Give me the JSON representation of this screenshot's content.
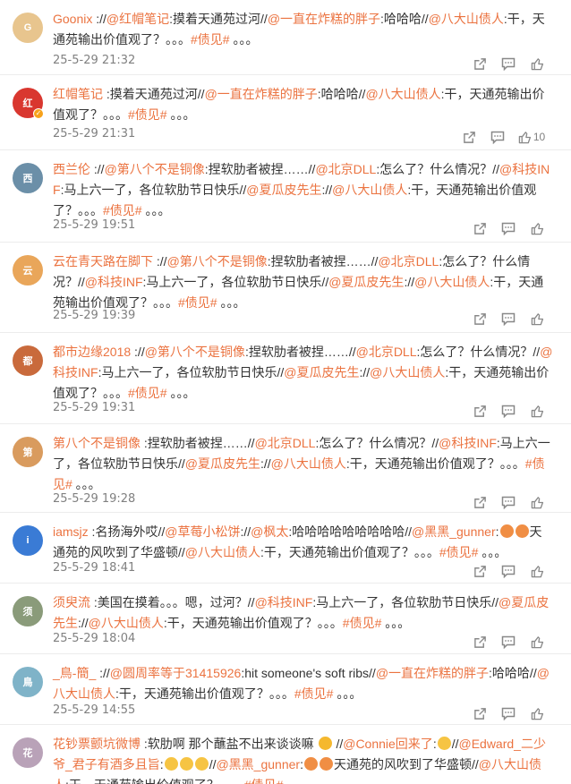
{
  "comments": [
    {
      "name": "Goonix",
      "avatar": {
        "color": "#e8c58e",
        "text": "G"
      },
      "segments": [
        {
          "t": "txt",
          "v": " ://"
        },
        {
          "t": "at",
          "v": "@红帽笔记"
        },
        {
          "t": "txt",
          "v": ":摸着天通苑过河//"
        },
        {
          "t": "at",
          "v": "@一直在炸糕的胖子"
        },
        {
          "t": "txt",
          "v": ":哈哈哈//"
        },
        {
          "t": "at",
          "v": "@八大山债人"
        },
        {
          "t": "txt",
          "v": ":干，天通苑输出价值观了？。。。"
        },
        {
          "t": "tag",
          "v": "#债见#"
        },
        {
          "t": "txt",
          "v": " 。。。"
        }
      ],
      "time": "25-5-29 21:32",
      "likes": ""
    },
    {
      "name": "红帽笔记",
      "avatar": {
        "color": "#d9372f",
        "text": "红",
        "badge": true
      },
      "segments": [
        {
          "t": "txt",
          "v": " :摸着天通苑过河//"
        },
        {
          "t": "at",
          "v": "@一直在炸糕的胖子"
        },
        {
          "t": "txt",
          "v": ":哈哈哈//"
        },
        {
          "t": "at",
          "v": "@八大山债人"
        },
        {
          "t": "txt",
          "v": ":干，天通苑输出价值观了？。。。"
        },
        {
          "t": "tag",
          "v": "#债见#"
        },
        {
          "t": "txt",
          "v": " 。。。"
        }
      ],
      "time": "25-5-29 21:31",
      "likes": "10"
    },
    {
      "name": "西兰伦",
      "avatar": {
        "color": "#6b8fa8",
        "text": "西"
      },
      "segments": [
        {
          "t": "txt",
          "v": " ://"
        },
        {
          "t": "at",
          "v": "@第八个不是铜像"
        },
        {
          "t": "txt",
          "v": ":捏软肋者被捏……//"
        },
        {
          "t": "at",
          "v": "@北京DLL"
        },
        {
          "t": "txt",
          "v": ":怎么了？什么情况？//"
        },
        {
          "t": "at",
          "v": "@科技INF"
        },
        {
          "t": "txt",
          "v": ":马上六一了，各位软肋节日快乐//"
        },
        {
          "t": "at",
          "v": "@夏瓜皮先生"
        },
        {
          "t": "txt",
          "v": "://"
        },
        {
          "t": "at",
          "v": "@八大山债人"
        },
        {
          "t": "txt",
          "v": ":干，天通苑输出价值观了？。。。"
        },
        {
          "t": "tag",
          "v": "#债见#"
        },
        {
          "t": "txt",
          "v": " 。。。"
        }
      ],
      "time": "25-5-29 19:51",
      "likes": ""
    },
    {
      "name": "云在青天路在脚下",
      "avatar": {
        "color": "#e9a65a",
        "text": "云"
      },
      "segments": [
        {
          "t": "txt",
          "v": " ://"
        },
        {
          "t": "at",
          "v": "@第八个不是铜像"
        },
        {
          "t": "txt",
          "v": ":捏软肋者被捏……//"
        },
        {
          "t": "at",
          "v": "@北京DLL"
        },
        {
          "t": "txt",
          "v": ":怎么了？什么情况？//"
        },
        {
          "t": "at",
          "v": "@科技INF"
        },
        {
          "t": "txt",
          "v": ":马上六一了，各位软肋节日快乐//"
        },
        {
          "t": "at",
          "v": "@夏瓜皮先生"
        },
        {
          "t": "txt",
          "v": "://"
        },
        {
          "t": "at",
          "v": "@八大山债人"
        },
        {
          "t": "txt",
          "v": ":干，天通苑输出价值观了？。。。"
        },
        {
          "t": "tag",
          "v": "#债见#"
        },
        {
          "t": "txt",
          "v": " 。。。"
        }
      ],
      "time": "25-5-29 19:39",
      "likes": ""
    },
    {
      "name": "都市边缘2018",
      "avatar": {
        "color": "#c96a3c",
        "text": "都"
      },
      "segments": [
        {
          "t": "txt",
          "v": " ://"
        },
        {
          "t": "at",
          "v": "@第八个不是铜像"
        },
        {
          "t": "txt",
          "v": ":捏软肋者被捏……//"
        },
        {
          "t": "at",
          "v": "@北京DLL"
        },
        {
          "t": "txt",
          "v": ":怎么了？什么情况？//"
        },
        {
          "t": "at",
          "v": "@科技INF"
        },
        {
          "t": "txt",
          "v": ":马上六一了，各位软肋节日快乐//"
        },
        {
          "t": "at",
          "v": "@夏瓜皮先生"
        },
        {
          "t": "txt",
          "v": "://"
        },
        {
          "t": "at",
          "v": "@八大山债人"
        },
        {
          "t": "txt",
          "v": ":干，天通苑输出价值观了？。。。"
        },
        {
          "t": "tag",
          "v": "#债见#"
        },
        {
          "t": "txt",
          "v": " 。。。"
        }
      ],
      "time": "25-5-29 19:31",
      "likes": ""
    },
    {
      "name": "第八个不是铜像",
      "avatar": {
        "color": "#d99b5e",
        "text": "第"
      },
      "segments": [
        {
          "t": "txt",
          "v": " :捏软肋者被捏……//"
        },
        {
          "t": "at",
          "v": "@北京DLL"
        },
        {
          "t": "txt",
          "v": ":怎么了？什么情况？//"
        },
        {
          "t": "at",
          "v": "@科技INF"
        },
        {
          "t": "txt",
          "v": ":马上六一了，各位软肋节日快乐//"
        },
        {
          "t": "at",
          "v": "@夏瓜皮先生"
        },
        {
          "t": "txt",
          "v": "://"
        },
        {
          "t": "at",
          "v": "@八大山债人"
        },
        {
          "t": "txt",
          "v": ":干，天通苑输出价值观了？。。。"
        },
        {
          "t": "tag",
          "v": "#债见#"
        },
        {
          "t": "txt",
          "v": " 。。。"
        }
      ],
      "time": "25-5-29 19:28",
      "likes": ""
    },
    {
      "name": "iamsjz",
      "avatar": {
        "color": "#3a7bd5",
        "text": "i"
      },
      "segments": [
        {
          "t": "txt",
          "v": " :名扬海外哎//"
        },
        {
          "t": "at",
          "v": "@草莓小松饼"
        },
        {
          "t": "txt",
          "v": "://"
        },
        {
          "t": "at",
          "v": "@枫太"
        },
        {
          "t": "txt",
          "v": ":哈哈哈哈哈哈哈哈哈//"
        },
        {
          "t": "at",
          "v": "@黑黑_gunner"
        },
        {
          "t": "txt",
          "v": ":"
        },
        {
          "t": "emoji",
          "v": "cry"
        },
        {
          "t": "emoji",
          "v": "cry"
        },
        {
          "t": "txt",
          "v": "天通苑的风吹到了华盛顿//"
        },
        {
          "t": "at",
          "v": "@八大山债人"
        },
        {
          "t": "txt",
          "v": ":干，天通苑输出价值观了？。。。"
        },
        {
          "t": "tag",
          "v": "#债见#"
        },
        {
          "t": "txt",
          "v": " 。。。"
        }
      ],
      "time": "25-5-29 18:41",
      "likes": ""
    },
    {
      "name": "须臾流",
      "avatar": {
        "color": "#8a9b7a",
        "text": "须"
      },
      "segments": [
        {
          "t": "txt",
          "v": " :美国在摸着。。。嗯，过河？//"
        },
        {
          "t": "at",
          "v": "@科技INF"
        },
        {
          "t": "txt",
          "v": ":马上六一了，各位软肋节日快乐//"
        },
        {
          "t": "at",
          "v": "@夏瓜皮先生"
        },
        {
          "t": "txt",
          "v": "://"
        },
        {
          "t": "at",
          "v": "@八大山债人"
        },
        {
          "t": "txt",
          "v": ":干，天通苑输出价值观了？。。。"
        },
        {
          "t": "tag",
          "v": "#债见#"
        },
        {
          "t": "txt",
          "v": " 。。。"
        }
      ],
      "time": "25-5-29 18:04",
      "likes": ""
    },
    {
      "name": "_鳥-簡_",
      "avatar": {
        "color": "#7fb3c8",
        "text": "鳥"
      },
      "segments": [
        {
          "t": "txt",
          "v": " ://"
        },
        {
          "t": "at",
          "v": "@圆周率等于31415926"
        },
        {
          "t": "txt",
          "v": ":hit someone's soft ribs//"
        },
        {
          "t": "at",
          "v": "@一直在炸糕的胖子"
        },
        {
          "t": "txt",
          "v": ":哈哈哈//"
        },
        {
          "t": "at",
          "v": "@八大山债人"
        },
        {
          "t": "txt",
          "v": ":干，天通苑输出价值观了？。。。"
        },
        {
          "t": "tag",
          "v": "#债见#"
        },
        {
          "t": "txt",
          "v": " 。。。"
        }
      ],
      "time": "25-5-29 14:55",
      "likes": ""
    },
    {
      "name": "花钞票颤坑微博",
      "avatar": {
        "color": "#b9a2b8",
        "text": "花"
      },
      "segments": [
        {
          "t": "txt",
          "v": " :软肋啊 那个蘸盐不出来谈谈嘛 "
        },
        {
          "t": "emoji",
          "v": "smile"
        },
        {
          "t": "txt",
          "v": " //"
        },
        {
          "t": "at",
          "v": "@Connie回来了"
        },
        {
          "t": "txt",
          "v": ":"
        },
        {
          "t": "emoji",
          "v": "sweat"
        },
        {
          "t": "txt",
          "v": "//"
        },
        {
          "t": "at",
          "v": "@Edward_二少爷_君子有酒多且旨"
        },
        {
          "t": "txt",
          "v": ":"
        },
        {
          "t": "emoji",
          "v": "sweat"
        },
        {
          "t": "emoji",
          "v": "sweat"
        },
        {
          "t": "emoji",
          "v": "sweat"
        },
        {
          "t": "txt",
          "v": "//"
        },
        {
          "t": "at",
          "v": "@黑黑_gunner"
        },
        {
          "t": "txt",
          "v": ":"
        },
        {
          "t": "emoji",
          "v": "cry"
        },
        {
          "t": "emoji",
          "v": "cry"
        },
        {
          "t": "txt",
          "v": "天通苑的风吹到了华盛顿//"
        },
        {
          "t": "at",
          "v": "@八大山债人"
        },
        {
          "t": "txt",
          "v": ":干，天通苑输出价值观了？。。。"
        },
        {
          "t": "tag",
          "v": "#债见#"
        },
        {
          "t": "txt",
          "v": " 。。。"
        }
      ],
      "time": "",
      "likes": ""
    }
  ]
}
